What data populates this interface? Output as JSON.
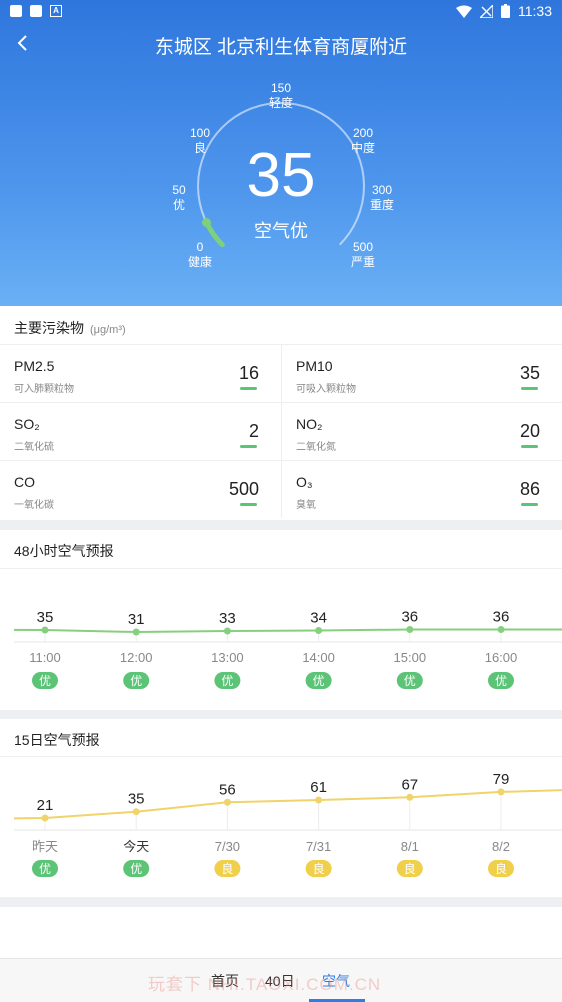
{
  "status_bar": {
    "time": "11:33"
  },
  "header": {
    "title": "东城区 北京利生体育商厦附近"
  },
  "gauge": {
    "aqi": "35",
    "category": "空气优",
    "fraction": 0.07,
    "ticks": [
      {
        "value": "0",
        "label": "健康"
      },
      {
        "value": "50",
        "label": "优"
      },
      {
        "value": "100",
        "label": "良"
      },
      {
        "value": "150",
        "label": "轻度"
      },
      {
        "value": "200",
        "label": "中度"
      },
      {
        "value": "300",
        "label": "重度"
      },
      {
        "value": "500",
        "label": "严重"
      }
    ]
  },
  "pollutants": {
    "title": "主要污染物",
    "unit": "(μg/m³)",
    "items": [
      {
        "name": "PM2.5",
        "desc": "可入肺颗粒物",
        "value": "16"
      },
      {
        "name": "PM10",
        "desc": "可吸入颗粒物",
        "value": "35"
      },
      {
        "name": "SO₂",
        "desc": "二氧化硫",
        "value": "2"
      },
      {
        "name": "NO₂",
        "desc": "二氧化氮",
        "value": "20"
      },
      {
        "name": "CO",
        "desc": "一氧化碳",
        "value": "500"
      },
      {
        "name": "O₃",
        "desc": "臭氧",
        "value": "86"
      }
    ]
  },
  "hourly": {
    "title": "48小时空气预报",
    "items": [
      {
        "time": "11:00",
        "value": "35",
        "level": "优"
      },
      {
        "time": "12:00",
        "value": "31",
        "level": "优"
      },
      {
        "time": "13:00",
        "value": "33",
        "level": "优"
      },
      {
        "time": "14:00",
        "value": "34",
        "level": "优"
      },
      {
        "time": "15:00",
        "value": "36",
        "level": "优"
      },
      {
        "time": "16:00",
        "value": "36",
        "level": "优"
      }
    ]
  },
  "daily": {
    "title": "15日空气预报",
    "items": [
      {
        "day": "昨天",
        "value": "21",
        "level": "优"
      },
      {
        "day": "今天",
        "value": "35",
        "level": "优"
      },
      {
        "day": "7/30",
        "value": "56",
        "level": "良"
      },
      {
        "day": "7/31",
        "value": "61",
        "level": "良"
      },
      {
        "day": "8/1",
        "value": "67",
        "level": "良"
      },
      {
        "day": "8/2",
        "value": "79",
        "level": "良"
      }
    ]
  },
  "colors": {
    "good": "#5cc476",
    "moderate": "#f0cf4a",
    "accent": "#2f7ee6"
  },
  "bottom_nav": {
    "items": [
      "首页",
      "40日",
      "空气"
    ],
    "active": "空气"
  },
  "watermark": "玩套下 NHI.TAOXI.COM.CN"
}
